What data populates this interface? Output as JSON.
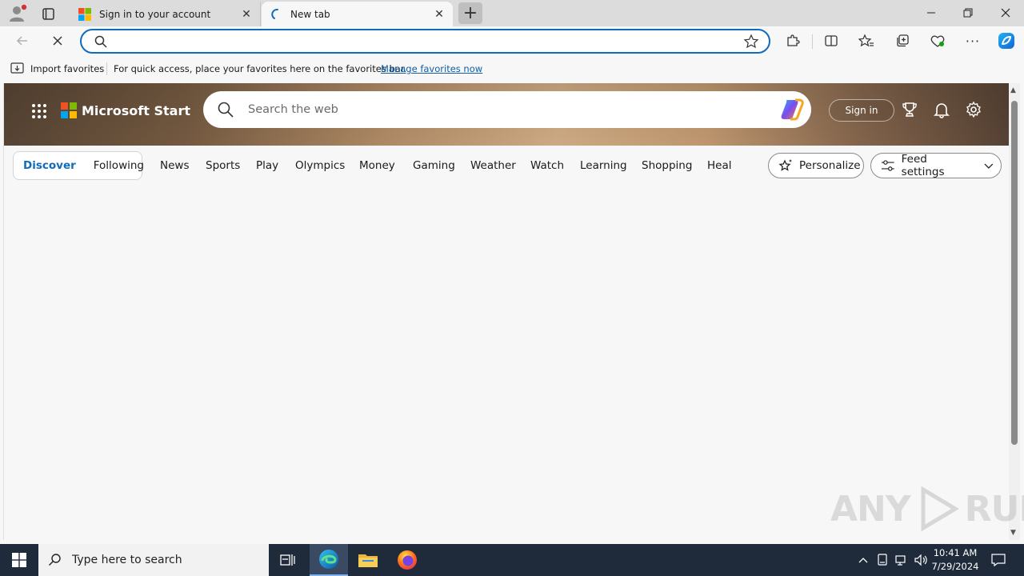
{
  "tabs": [
    {
      "title": "Sign in to your account",
      "active": false
    },
    {
      "title": "New tab",
      "active": true
    }
  ],
  "address_bar": {
    "value": "",
    "placeholder": ""
  },
  "favorites_bar": {
    "import_label": "Import favorites",
    "message": "For quick access, place your favorites here on the favorites bar.",
    "link": "Manage favorites now"
  },
  "header": {
    "brand": "Microsoft Start",
    "search_placeholder": "Search the web",
    "signin_label": "Sign in"
  },
  "nav": {
    "discover": "Discover",
    "following": "Following",
    "items": [
      "News",
      "Sports",
      "Play",
      "Olympics",
      "Money",
      "Gaming",
      "Weather",
      "Watch",
      "Learning",
      "Shopping",
      "Heal"
    ],
    "personalize": "Personalize",
    "feed_settings": "Feed settings"
  },
  "watermark": {
    "left": "ANY",
    "right": "RUN"
  },
  "taskbar": {
    "search_placeholder": "Type here to search",
    "time": "10:41 AM",
    "date": "7/29/2024"
  },
  "colors": {
    "accent": "#0f6cbd",
    "taskbar": "#1f2a3a"
  }
}
